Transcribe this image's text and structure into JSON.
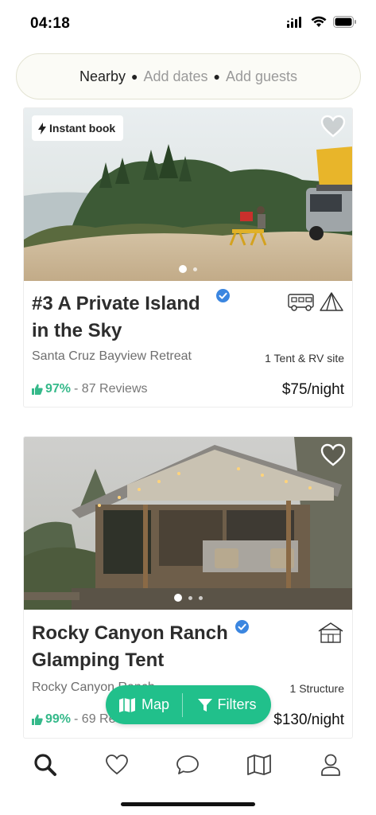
{
  "status": {
    "time": "04:18"
  },
  "search": {
    "location": "Nearby",
    "dates": "Add dates",
    "guests": "Add guests"
  },
  "listings": [
    {
      "badge": "Instant book",
      "title_line1": "#3 A Private Island",
      "title_line2": "in the Sky",
      "host": "Santa Cruz Bayview Retreat",
      "site_type": "1 Tent & RV site",
      "rating": "97%",
      "reviews": "- 87 Reviews",
      "price": "$75/night",
      "icons": [
        "rv-icon",
        "tent-icon"
      ]
    },
    {
      "title_line1": "Rocky Canyon Ranch",
      "title_line2": "Glamping Tent",
      "host": "Rocky Canyon Ranch",
      "site_type": "1 Structure",
      "rating": "99%",
      "reviews": "- 69 Reviews",
      "price": "$130/night",
      "icons": [
        "cabin-icon"
      ]
    }
  ],
  "fab": {
    "map": "Map",
    "filters": "Filters"
  },
  "tabs": [
    "search-icon",
    "heart-icon",
    "chat-icon",
    "map-icon",
    "profile-icon"
  ],
  "colors": {
    "accent": "#21c08b",
    "rating": "#35b98a",
    "verified": "#3b86e0"
  }
}
